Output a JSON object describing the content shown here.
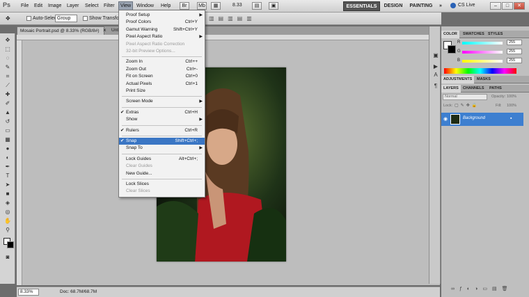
{
  "app": {
    "logo": "Ps"
  },
  "menubar": {
    "items": [
      "File",
      "Edit",
      "Image",
      "Layer",
      "Select",
      "Filter",
      "View",
      "Window",
      "Help"
    ],
    "zoom": "8.33",
    "workspaces": [
      "ESSENTIALS",
      "DESIGN",
      "PAINTING"
    ],
    "more": "»",
    "cs_live": "CS Live",
    "window_buttons": [
      "–",
      "□",
      "✕"
    ]
  },
  "options": {
    "auto_select_label": "Auto-Select:",
    "auto_select_value": "Group",
    "show_transform": "Show Transform"
  },
  "document": {
    "tab_active": "Mosaic Portrait.psd @ 8.33% (RGB/8#)",
    "tab_close": "×",
    "tab_other": "Unt",
    "status_zoom": "8.33%",
    "status_doc": "Doc: 68.7M/68.7M"
  },
  "view_menu": [
    {
      "label": "Proof Setup",
      "shortcut": "",
      "submenu": true,
      "enabled": true,
      "checked": false
    },
    {
      "label": "Proof Colors",
      "shortcut": "Ctrl+Y",
      "submenu": false,
      "enabled": true,
      "checked": false
    },
    {
      "label": "Gamut Warning",
      "shortcut": "Shift+Ctrl+Y",
      "submenu": false,
      "enabled": true,
      "checked": false
    },
    {
      "label": "Pixel Aspect Ratio",
      "shortcut": "",
      "submenu": true,
      "enabled": true,
      "checked": false
    },
    {
      "label": "Pixel Aspect Ratio Correction",
      "shortcut": "",
      "submenu": false,
      "enabled": false,
      "checked": false
    },
    {
      "label": "32-bit Preview Options...",
      "shortcut": "",
      "submenu": false,
      "enabled": false,
      "checked": false
    },
    {
      "sep": true
    },
    {
      "label": "Zoom In",
      "shortcut": "Ctrl++",
      "submenu": false,
      "enabled": true,
      "checked": false
    },
    {
      "label": "Zoom Out",
      "shortcut": "Ctrl+-",
      "submenu": false,
      "enabled": true,
      "checked": false
    },
    {
      "label": "Fit on Screen",
      "shortcut": "Ctrl+0",
      "submenu": false,
      "enabled": true,
      "checked": false
    },
    {
      "label": "Actual Pixels",
      "shortcut": "Ctrl+1",
      "submenu": false,
      "enabled": true,
      "checked": false
    },
    {
      "label": "Print Size",
      "shortcut": "",
      "submenu": false,
      "enabled": true,
      "checked": false
    },
    {
      "sep": true
    },
    {
      "label": "Screen Mode",
      "shortcut": "",
      "submenu": true,
      "enabled": true,
      "checked": false
    },
    {
      "sep": true
    },
    {
      "label": "Extras",
      "shortcut": "Ctrl+H",
      "submenu": false,
      "enabled": true,
      "checked": true
    },
    {
      "label": "Show",
      "shortcut": "",
      "submenu": true,
      "enabled": true,
      "checked": false
    },
    {
      "sep": true
    },
    {
      "label": "Rulers",
      "shortcut": "Ctrl+R",
      "submenu": false,
      "enabled": true,
      "checked": true
    },
    {
      "sep": true
    },
    {
      "label": "Snap",
      "shortcut": "Shift+Ctrl+;",
      "submenu": false,
      "enabled": true,
      "checked": true,
      "highlighted": true
    },
    {
      "label": "Snap To",
      "shortcut": "",
      "submenu": true,
      "enabled": true,
      "checked": false
    },
    {
      "sep": true
    },
    {
      "label": "Lock Guides",
      "shortcut": "Alt+Ctrl+;",
      "submenu": false,
      "enabled": true,
      "checked": false
    },
    {
      "label": "Clear Guides",
      "shortcut": "",
      "submenu": false,
      "enabled": false,
      "checked": false
    },
    {
      "label": "New Guide...",
      "shortcut": "",
      "submenu": false,
      "enabled": true,
      "checked": false
    },
    {
      "sep": true
    },
    {
      "label": "Lock Slices",
      "shortcut": "",
      "submenu": false,
      "enabled": true,
      "checked": false
    },
    {
      "label": "Clear Slices",
      "shortcut": "",
      "submenu": false,
      "enabled": false,
      "checked": false
    }
  ],
  "color_panel": {
    "tabs": [
      "COLOR",
      "SWATCHES",
      "STYLES"
    ],
    "channels": [
      {
        "name": "R",
        "value": "255"
      },
      {
        "name": "G",
        "value": "255"
      },
      {
        "name": "B",
        "value": "255"
      }
    ]
  },
  "adjust_panel": {
    "tabs": [
      "ADJUSTMENTS",
      "MASKS"
    ]
  },
  "layers_panel": {
    "tabs": [
      "LAYERS",
      "CHANNELS",
      "PATHS"
    ],
    "blend_mode": "Normal",
    "opacity_label": "Opacity:",
    "opacity": "100%",
    "lock_label": "Lock:",
    "fill_label": "Fill:",
    "fill": "100%",
    "layer_name": "Background"
  },
  "colors": {
    "accent": "#3a76c4",
    "highlight_menu": "#3a76c4"
  }
}
